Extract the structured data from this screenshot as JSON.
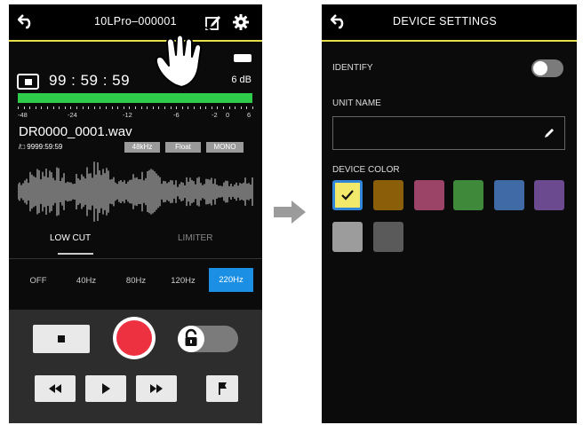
{
  "left_screen": {
    "header": {
      "title": "10LPro–000001",
      "back_icon": "back-arrow-icon",
      "edit_icon": "edit-icon",
      "settings_icon": "gear-icon"
    },
    "status": {
      "timecode": "99 : 59 : 59",
      "gain": "6 dB",
      "meter_scale": [
        "-48",
        "-24",
        "-12",
        "-6",
        "-2",
        "0",
        "6"
      ],
      "level_fraction": 1.0,
      "file_name": "DR0000_0001.wav",
      "remaining": "9999:59:59",
      "badges": [
        "48kHz",
        "Float",
        "MONO"
      ]
    },
    "tabs": [
      "LOW CUT",
      "LIMITER"
    ],
    "active_tab": "LOW CUT",
    "low_cut_options": [
      "OFF",
      "40Hz",
      "80Hz",
      "120Hz",
      "220Hz"
    ],
    "selected_low_cut": "220Hz",
    "transport": {
      "stop_icon": "stop-icon",
      "record_icon": "record-icon",
      "lock_icon": "padlock-icon",
      "rewind_icon": "rewind-icon",
      "play_icon": "play-icon",
      "fast_forward_icon": "fast-forward-icon",
      "mark_icon": "flag-icon"
    }
  },
  "right_screen": {
    "header": {
      "title": "DEVICE SETTINGS",
      "back_icon": "back-arrow-icon"
    },
    "identify_label": "IDENTIFY",
    "identify_on": false,
    "unit_name_label": "UNIT NAME",
    "unit_name_value": "",
    "device_color_label": "DEVICE COLOR",
    "colors": [
      "#f2e96a",
      "#8b5e0a",
      "#9b4468",
      "#3e8a3a",
      "#3f6aa6",
      "#6b4a8f",
      "#9c9c9c",
      "#5a5a5a"
    ],
    "selected_color_index": 0
  }
}
